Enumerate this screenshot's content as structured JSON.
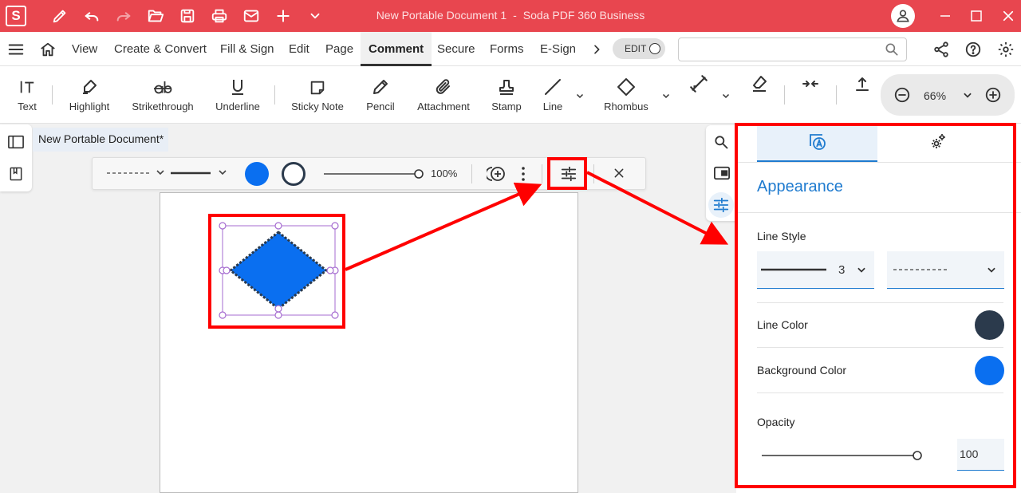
{
  "window": {
    "doc_title": "New Portable Document 1",
    "separator": "-",
    "app_name": "Soda PDF 360 Business",
    "logo_letter": "S"
  },
  "menu": {
    "items": [
      "View",
      "Create & Convert",
      "Fill & Sign",
      "Edit",
      "Page",
      "Comment",
      "Secure",
      "Forms",
      "E-Sign"
    ],
    "active": "Comment",
    "edit_toggle": "EDIT",
    "search_placeholder": ""
  },
  "toolbar": {
    "tools": [
      "Text",
      "Highlight",
      "Strikethrough",
      "Underline",
      "Sticky Note",
      "Pencil",
      "Attachment",
      "Stamp",
      "Line",
      "Rhombus"
    ],
    "zoom": "66%"
  },
  "document": {
    "tab_title": "New Portable Document*"
  },
  "annotation_bar": {
    "opacity_label": "100%",
    "fill_color": "#0a6ff0",
    "stroke_color": "#2b3a4c"
  },
  "panel": {
    "heading": "Appearance",
    "line_style_label": "Line Style",
    "line_width": "3",
    "line_color_label": "Line Color",
    "line_color": "#2b3a4c",
    "background_color_label": "Background Color",
    "background_color": "#0a6ff0",
    "opacity_label": "Opacity",
    "opacity_value": "100",
    "opacity_fraction": 1.0
  },
  "colors": {
    "brand": "#e8464f",
    "accent": "#1f7bcf",
    "highlight": "#ff0000"
  }
}
